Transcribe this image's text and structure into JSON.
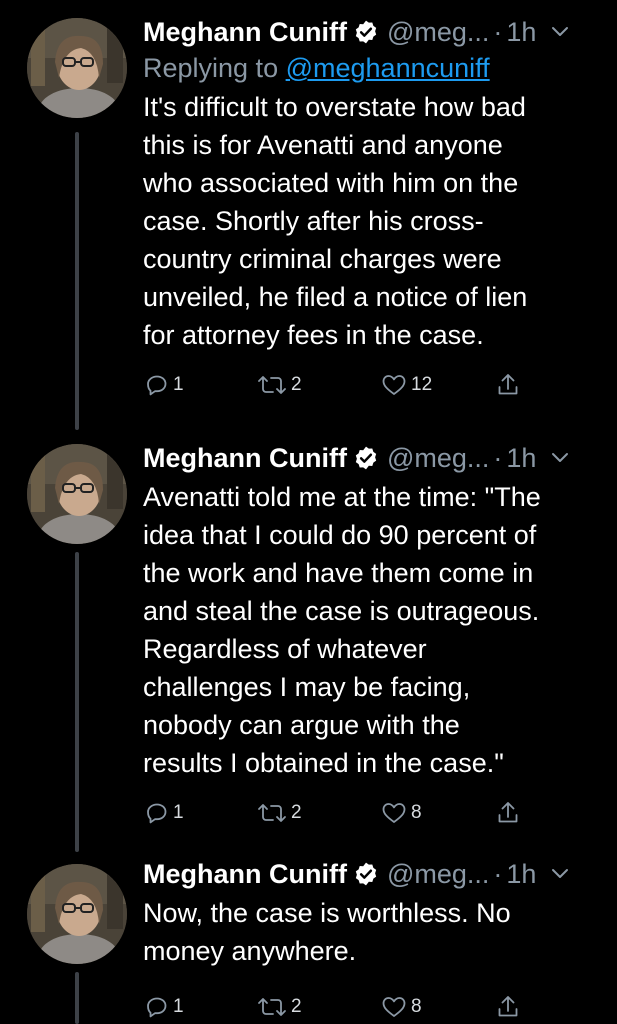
{
  "tweets": [
    {
      "author_name": "Meghann Cuniff",
      "handle": "@meg...",
      "separator": "·",
      "time": "1h",
      "replying_prefix": "Replying to",
      "replying_to": "@meghanncuniff",
      "lines": [
        "It's difficult to overstate how bad",
        "this is for Avenatti and anyone",
        "who associated with him on the",
        "case. Shortly after his cross-",
        "country criminal charges were",
        "unveiled, he filed a notice of lien",
        "for attorney fees in the case."
      ],
      "replies": "1",
      "retweets": "2",
      "likes": "12"
    },
    {
      "author_name": "Meghann Cuniff",
      "handle": "@meg...",
      "separator": "·",
      "time": "1h",
      "lines": [
        "Avenatti told me at the time: \"The",
        "idea that I could do 90 percent of",
        "the work and have them come in",
        "and steal the case is outrageous.",
        "Regardless of whatever",
        "challenges I may be facing,",
        "nobody can argue with the",
        "results I obtained in the case.\""
      ],
      "replies": "1",
      "retweets": "2",
      "likes": "8"
    },
    {
      "author_name": "Meghann Cuniff",
      "handle": "@meg...",
      "separator": "·",
      "time": "1h",
      "lines": [
        "Now, the case is worthless. No",
        "money anywhere."
      ],
      "replies": "1",
      "retweets": "2",
      "likes": "8"
    }
  ],
  "icons": {
    "verified": "verified-badge-icon",
    "chevron": "chevron-down-icon",
    "reply": "reply-icon",
    "retweet": "retweet-icon",
    "like": "heart-icon",
    "share": "share-icon"
  },
  "colors": {
    "background": "#000000",
    "text": "#ffffff",
    "secondary": "#8b98a5",
    "link": "#1d9bf0",
    "thread_line": "#3d4147"
  }
}
